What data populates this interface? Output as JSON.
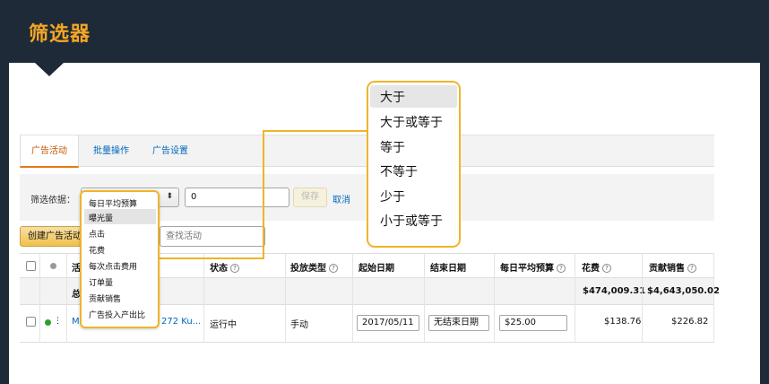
{
  "header": {
    "title": "筛选器"
  },
  "tabs": [
    {
      "label": "广告活动",
      "active": true
    },
    {
      "label": "批量操作",
      "active": false
    },
    {
      "label": "广告设置",
      "active": false
    }
  ],
  "filter": {
    "label": "筛选依据：",
    "selected": "每日平均预算",
    "value": "0",
    "save_label": "保存",
    "cancel_label": "取消"
  },
  "toolbar": {
    "create_label": "创建广告活动",
    "search_placeholder": "查找活动"
  },
  "filter_options": [
    "每日平均预算",
    "曝光量",
    "点击",
    "花费",
    "每次点击费用",
    "订单量",
    "贡献销售",
    "广告投入产出比"
  ],
  "comparison_options": [
    "大于",
    "大于或等于",
    "等于",
    "不等于",
    "少于",
    "小于或等于"
  ],
  "table": {
    "columns": {
      "name": "活",
      "status": "状态",
      "targeting": "投放类型",
      "start_date": "起始日期",
      "end_date": "结束日期",
      "daily_budget": "每日平均预算",
      "spend": "花费",
      "sales": "贡献销售"
    },
    "totals": {
      "label": "总",
      "spend": "$474,009.31",
      "sales": "$4,643,050.02"
    },
    "row": {
      "name_prefix": "M",
      "name_suffix": "272 Ku...",
      "status": "运行中",
      "targeting": "手动",
      "start_date": "2017/05/11",
      "end_date": "无结束日期",
      "daily_budget": "$25.00",
      "spend": "$138.76",
      "sales": "$226.82"
    }
  },
  "colors": {
    "header_bg": "#1f2a38",
    "title": "#f5a623",
    "highlight_border": "#f0b429",
    "active_tab": "#c45500",
    "link": "#0066c0",
    "status_running": "#2ca02c"
  }
}
